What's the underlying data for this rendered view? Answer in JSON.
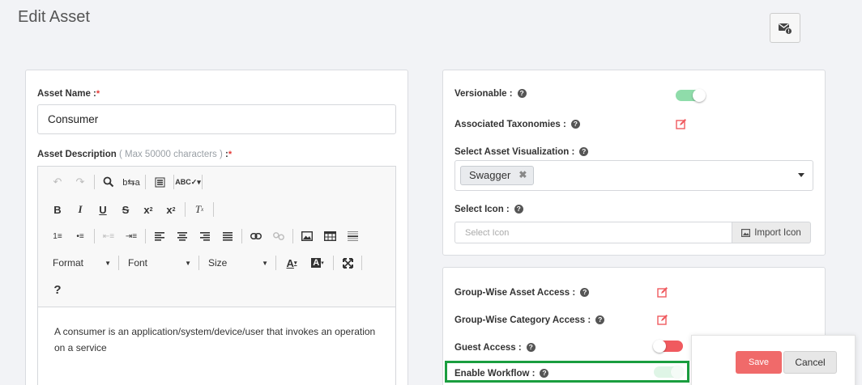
{
  "page": {
    "title": "Edit Asset",
    "mail_icon": "envelope-info-icon"
  },
  "asset_name": {
    "label": "Asset Name :",
    "required_mark": "*",
    "value": "Consumer"
  },
  "asset_description": {
    "label": "Asset Description",
    "hint": "( Max 50000 characters )",
    "label_suffix": " :",
    "required_mark": "*",
    "text": "A consumer is an application/system/device/user that invokes an operation on a service"
  },
  "editor_toolbar": {
    "format_label": "Format",
    "font_label": "Font",
    "size_label": "Size",
    "help_label": "?"
  },
  "right_panel": {
    "versionable": {
      "label": "Versionable :",
      "enabled": true
    },
    "associated_taxonomies": {
      "label": "Associated Taxonomies :"
    },
    "asset_visualization": {
      "label": "Select Asset Visualization :",
      "selected": "Swagger",
      "remove_glyph": "✖"
    },
    "select_icon": {
      "label": "Select Icon :",
      "placeholder": "Select Icon",
      "import_label": "Import Icon"
    }
  },
  "access_panel": {
    "group_asset_access": {
      "label": "Group-Wise Asset Access :"
    },
    "group_category_access": {
      "label": "Group-Wise Category Access :"
    },
    "guest_access": {
      "label": "Guest Access :",
      "enabled": false
    },
    "enable_workflow": {
      "label": "Enable Workflow :",
      "enabled": true
    }
  },
  "actions": {
    "save_label": "Save",
    "cancel_label": "Cancel"
  },
  "colors": {
    "toggle_on": "#8fdcaa",
    "toggle_off": "#f05a5f",
    "save": "#f06a6a",
    "highlight": "#1a9e3f",
    "edit_icon": "#f05a5f"
  }
}
